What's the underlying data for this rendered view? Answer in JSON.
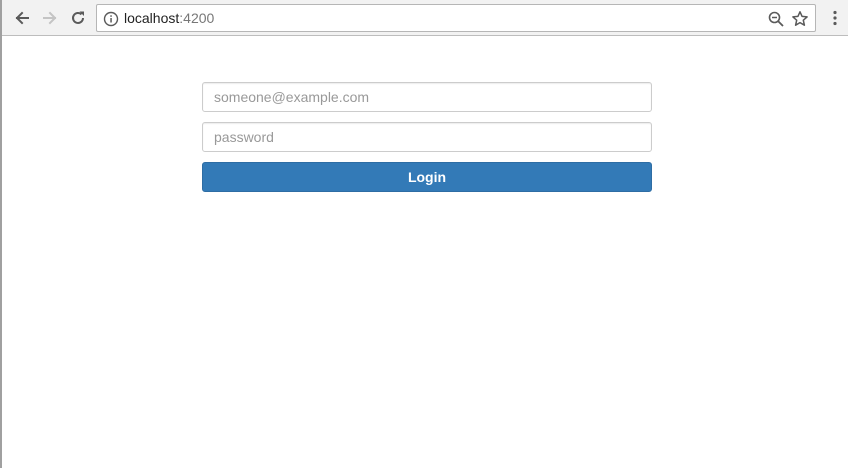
{
  "browser": {
    "address_host": "localhost",
    "address_port": ":4200",
    "icons": {
      "back": "back-arrow-icon",
      "forward": "forward-arrow-icon",
      "reload": "reload-icon",
      "info": "info-icon",
      "zoom": "zoom-out-icon",
      "bookmark": "star-icon",
      "menu": "kebab-menu-icon"
    }
  },
  "login": {
    "email_placeholder": "someone@example.com",
    "email_value": "",
    "password_placeholder": "password",
    "password_value": "",
    "button_label": "Login"
  },
  "colors": {
    "primary": "#337ab7",
    "primary_border": "#2e6da4",
    "toolbar_bg": "#f2f2f2"
  }
}
